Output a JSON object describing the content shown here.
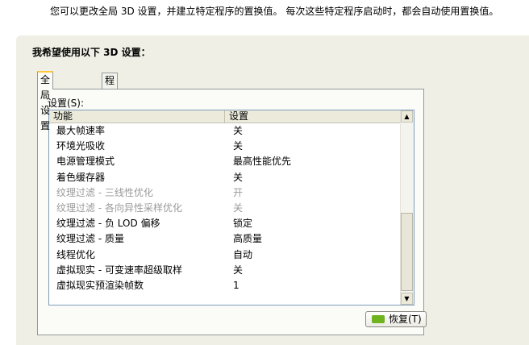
{
  "intro_text": "您可以更改全局 3D 设置，并建立特定程序的置换值。 每次这些特定程序启动时，都会自动使用置换值。",
  "panel": {
    "heading": "我希望使用以下 3D 设置："
  },
  "tabs": [
    {
      "label": "全局设置",
      "active": true
    },
    {
      "label": "程序设置",
      "active": false
    }
  ],
  "settings_label": "设置(S):",
  "columns": [
    "功能",
    "设置"
  ],
  "rows": [
    {
      "name": "最大帧速率",
      "value": "关",
      "enabled": true
    },
    {
      "name": "环境光吸收",
      "value": "关",
      "enabled": true
    },
    {
      "name": "电源管理模式",
      "value": "最高性能优先",
      "enabled": true
    },
    {
      "name": "着色缓存器",
      "value": "关",
      "enabled": true
    },
    {
      "name": "纹理过滤 - 三线性优化",
      "value": "开",
      "enabled": false
    },
    {
      "name": "纹理过滤 - 各向异性采样优化",
      "value": "关",
      "enabled": false
    },
    {
      "name": "纹理过滤 - 负 LOD 偏移",
      "value": "锁定",
      "enabled": true
    },
    {
      "name": "纹理过滤 - 质量",
      "value": "高质量",
      "enabled": true
    },
    {
      "name": "线程优化",
      "value": "自动",
      "enabled": true
    },
    {
      "name": "虚拟现实 - 可变速率超级取样",
      "value": "关",
      "enabled": true
    },
    {
      "name": "虚拟现实预渲染帧数",
      "value": "1",
      "enabled": true
    }
  ],
  "scroll_icons": {
    "up": "scroll-up-arrow",
    "down": "scroll-down-arrow"
  },
  "restore_button": {
    "label": "恢复(T)",
    "icon": "nvidia-logo-icon",
    "icon_color": "#6fb31f"
  }
}
